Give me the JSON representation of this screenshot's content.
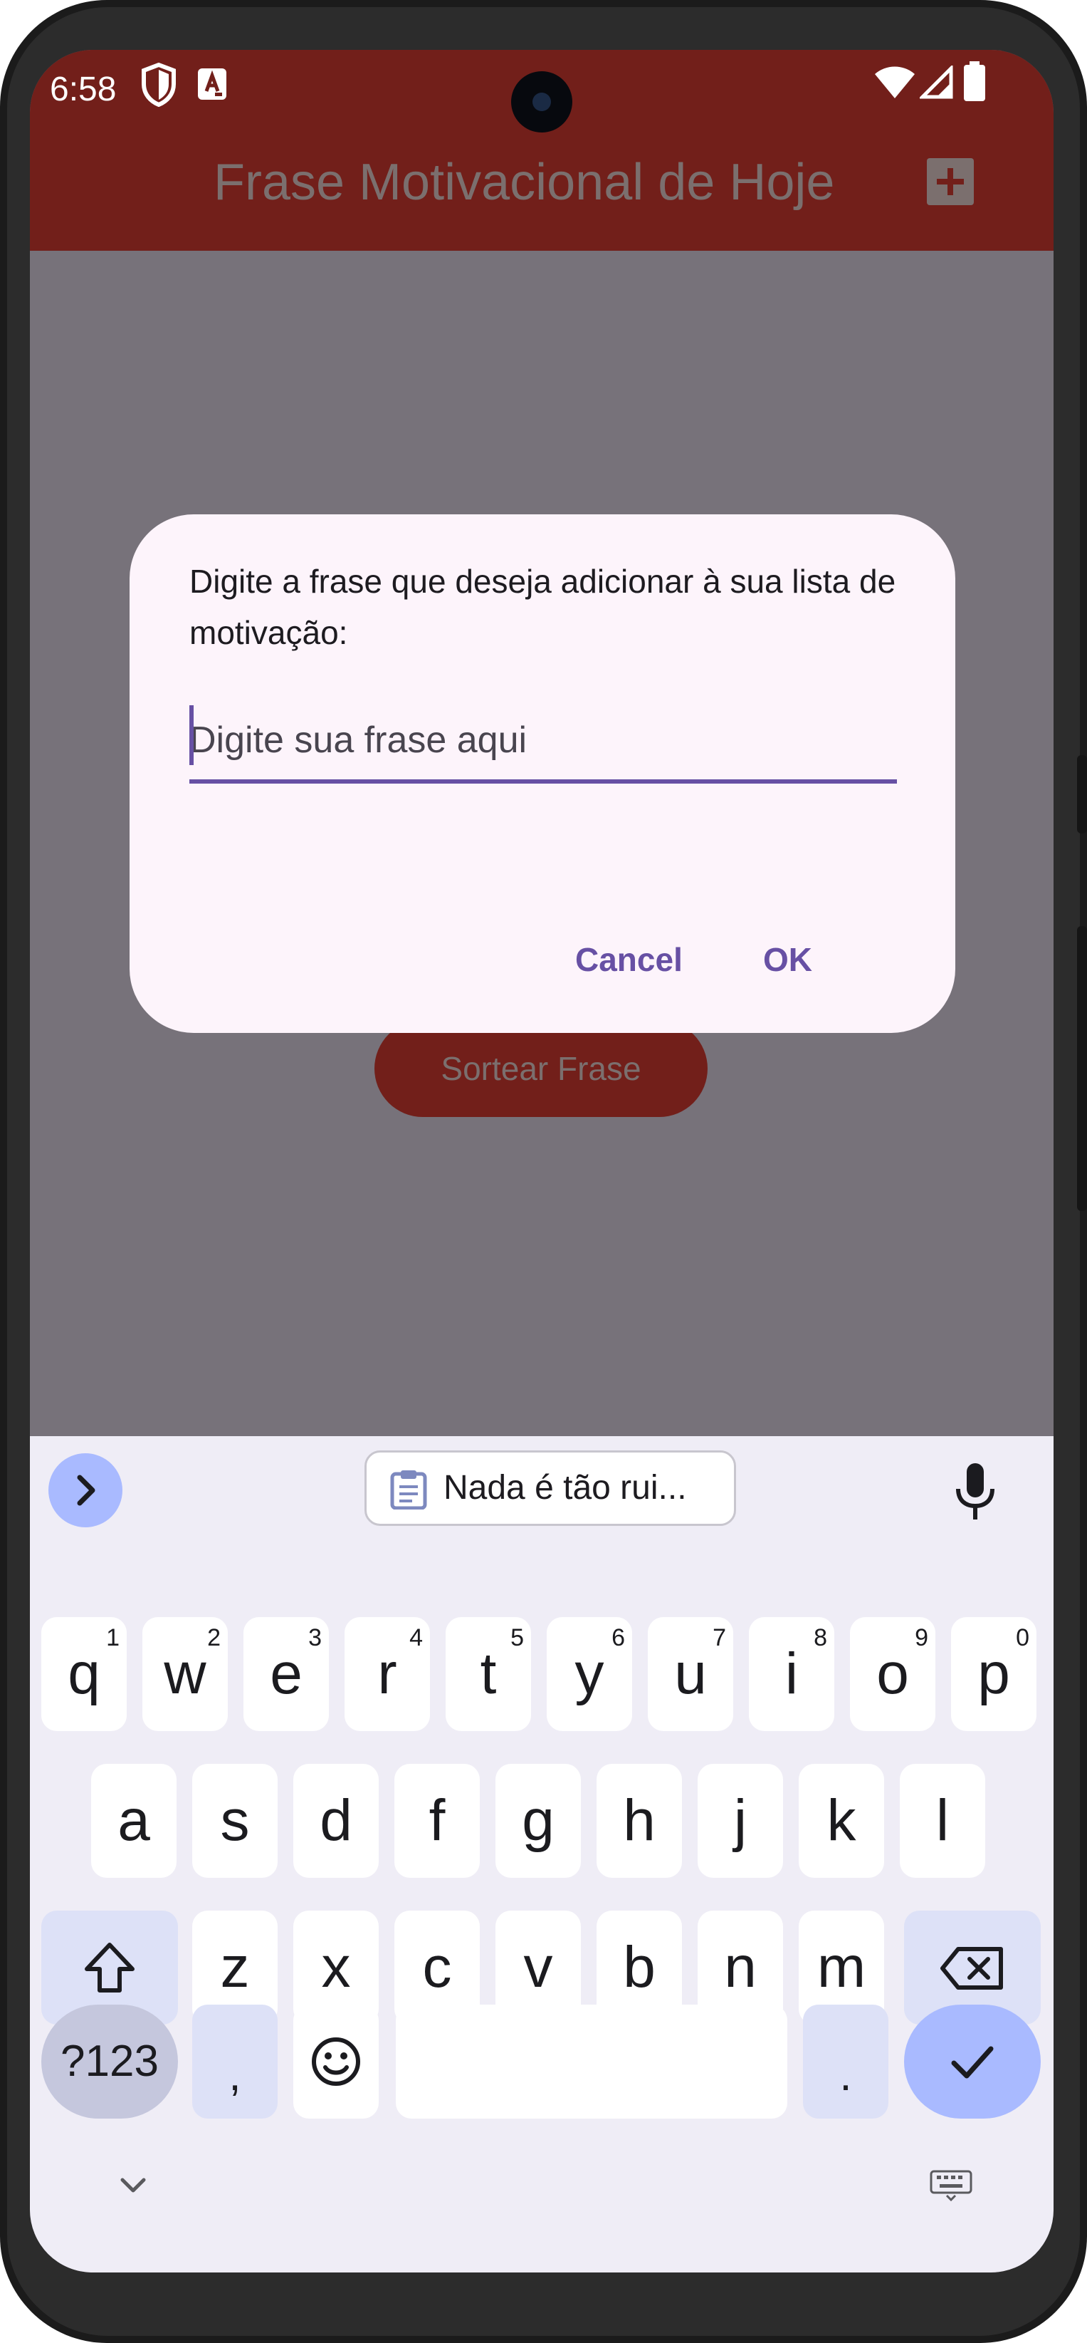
{
  "status_bar": {
    "time": "6:58",
    "icons": [
      "shield-icon",
      "keyboard-a-icon",
      "wifi-icon",
      "signal-icon",
      "battery-icon"
    ]
  },
  "app_bar": {
    "title": "Frase Motivacional de Hoje",
    "add_icon": "add-box-icon",
    "background_color": "#721f1a"
  },
  "main": {
    "draw_button_label": "Sortear Frase"
  },
  "dialog": {
    "message": "Digite a frase que deseja adicionar à sua lista de motivação:",
    "input_placeholder": "Digite sua frase aqui",
    "input_value": "",
    "cancel_label": "Cancel",
    "ok_label": "OK",
    "accent_color": "#6750a4"
  },
  "keyboard": {
    "toolbar": {
      "expand_icon": "chevron-right-icon",
      "clipboard_icon": "clipboard-icon",
      "clipboard_suggestion": "Nada é tão rui...",
      "mic_icon": "microphone-icon"
    },
    "row1": [
      {
        "key": "q",
        "hint": "1"
      },
      {
        "key": "w",
        "hint": "2"
      },
      {
        "key": "e",
        "hint": "3"
      },
      {
        "key": "r",
        "hint": "4"
      },
      {
        "key": "t",
        "hint": "5"
      },
      {
        "key": "y",
        "hint": "6"
      },
      {
        "key": "u",
        "hint": "7"
      },
      {
        "key": "i",
        "hint": "8"
      },
      {
        "key": "o",
        "hint": "9"
      },
      {
        "key": "p",
        "hint": "0"
      }
    ],
    "row2": [
      "a",
      "s",
      "d",
      "f",
      "g",
      "h",
      "j",
      "k",
      "l"
    ],
    "row3": [
      "z",
      "x",
      "c",
      "v",
      "b",
      "n",
      "m"
    ],
    "symbols_label": "?123",
    "comma_label": ",",
    "period_label": ".",
    "icons": [
      "shift-icon",
      "backspace-icon",
      "emoji-icon",
      "checkmark-icon",
      "hide-keyboard-icon",
      "keyboard-switch-icon"
    ]
  }
}
